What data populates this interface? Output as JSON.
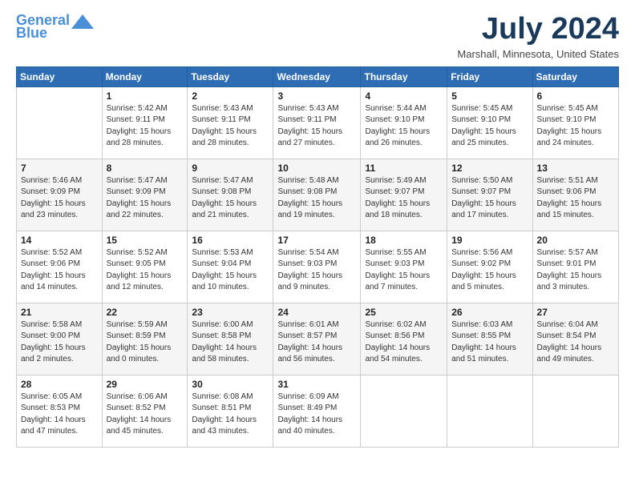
{
  "header": {
    "logo_line1": "General",
    "logo_line2": "Blue",
    "month": "July 2024",
    "location": "Marshall, Minnesota, United States"
  },
  "weekdays": [
    "Sunday",
    "Monday",
    "Tuesday",
    "Wednesday",
    "Thursday",
    "Friday",
    "Saturday"
  ],
  "weeks": [
    [
      {
        "day": "",
        "info": ""
      },
      {
        "day": "1",
        "info": "Sunrise: 5:42 AM\nSunset: 9:11 PM\nDaylight: 15 hours\nand 28 minutes."
      },
      {
        "day": "2",
        "info": "Sunrise: 5:43 AM\nSunset: 9:11 PM\nDaylight: 15 hours\nand 28 minutes."
      },
      {
        "day": "3",
        "info": "Sunrise: 5:43 AM\nSunset: 9:11 PM\nDaylight: 15 hours\nand 27 minutes."
      },
      {
        "day": "4",
        "info": "Sunrise: 5:44 AM\nSunset: 9:10 PM\nDaylight: 15 hours\nand 26 minutes."
      },
      {
        "day": "5",
        "info": "Sunrise: 5:45 AM\nSunset: 9:10 PM\nDaylight: 15 hours\nand 25 minutes."
      },
      {
        "day": "6",
        "info": "Sunrise: 5:45 AM\nSunset: 9:10 PM\nDaylight: 15 hours\nand 24 minutes."
      }
    ],
    [
      {
        "day": "7",
        "info": "Sunrise: 5:46 AM\nSunset: 9:09 PM\nDaylight: 15 hours\nand 23 minutes."
      },
      {
        "day": "8",
        "info": "Sunrise: 5:47 AM\nSunset: 9:09 PM\nDaylight: 15 hours\nand 22 minutes."
      },
      {
        "day": "9",
        "info": "Sunrise: 5:47 AM\nSunset: 9:08 PM\nDaylight: 15 hours\nand 21 minutes."
      },
      {
        "day": "10",
        "info": "Sunrise: 5:48 AM\nSunset: 9:08 PM\nDaylight: 15 hours\nand 19 minutes."
      },
      {
        "day": "11",
        "info": "Sunrise: 5:49 AM\nSunset: 9:07 PM\nDaylight: 15 hours\nand 18 minutes."
      },
      {
        "day": "12",
        "info": "Sunrise: 5:50 AM\nSunset: 9:07 PM\nDaylight: 15 hours\nand 17 minutes."
      },
      {
        "day": "13",
        "info": "Sunrise: 5:51 AM\nSunset: 9:06 PM\nDaylight: 15 hours\nand 15 minutes."
      }
    ],
    [
      {
        "day": "14",
        "info": "Sunrise: 5:52 AM\nSunset: 9:06 PM\nDaylight: 15 hours\nand 14 minutes."
      },
      {
        "day": "15",
        "info": "Sunrise: 5:52 AM\nSunset: 9:05 PM\nDaylight: 15 hours\nand 12 minutes."
      },
      {
        "day": "16",
        "info": "Sunrise: 5:53 AM\nSunset: 9:04 PM\nDaylight: 15 hours\nand 10 minutes."
      },
      {
        "day": "17",
        "info": "Sunrise: 5:54 AM\nSunset: 9:03 PM\nDaylight: 15 hours\nand 9 minutes."
      },
      {
        "day": "18",
        "info": "Sunrise: 5:55 AM\nSunset: 9:03 PM\nDaylight: 15 hours\nand 7 minutes."
      },
      {
        "day": "19",
        "info": "Sunrise: 5:56 AM\nSunset: 9:02 PM\nDaylight: 15 hours\nand 5 minutes."
      },
      {
        "day": "20",
        "info": "Sunrise: 5:57 AM\nSunset: 9:01 PM\nDaylight: 15 hours\nand 3 minutes."
      }
    ],
    [
      {
        "day": "21",
        "info": "Sunrise: 5:58 AM\nSunset: 9:00 PM\nDaylight: 15 hours\nand 2 minutes."
      },
      {
        "day": "22",
        "info": "Sunrise: 5:59 AM\nSunset: 8:59 PM\nDaylight: 15 hours\nand 0 minutes."
      },
      {
        "day": "23",
        "info": "Sunrise: 6:00 AM\nSunset: 8:58 PM\nDaylight: 14 hours\nand 58 minutes."
      },
      {
        "day": "24",
        "info": "Sunrise: 6:01 AM\nSunset: 8:57 PM\nDaylight: 14 hours\nand 56 minutes."
      },
      {
        "day": "25",
        "info": "Sunrise: 6:02 AM\nSunset: 8:56 PM\nDaylight: 14 hours\nand 54 minutes."
      },
      {
        "day": "26",
        "info": "Sunrise: 6:03 AM\nSunset: 8:55 PM\nDaylight: 14 hours\nand 51 minutes."
      },
      {
        "day": "27",
        "info": "Sunrise: 6:04 AM\nSunset: 8:54 PM\nDaylight: 14 hours\nand 49 minutes."
      }
    ],
    [
      {
        "day": "28",
        "info": "Sunrise: 6:05 AM\nSunset: 8:53 PM\nDaylight: 14 hours\nand 47 minutes."
      },
      {
        "day": "29",
        "info": "Sunrise: 6:06 AM\nSunset: 8:52 PM\nDaylight: 14 hours\nand 45 minutes."
      },
      {
        "day": "30",
        "info": "Sunrise: 6:08 AM\nSunset: 8:51 PM\nDaylight: 14 hours\nand 43 minutes."
      },
      {
        "day": "31",
        "info": "Sunrise: 6:09 AM\nSunset: 8:49 PM\nDaylight: 14 hours\nand 40 minutes."
      },
      {
        "day": "",
        "info": ""
      },
      {
        "day": "",
        "info": ""
      },
      {
        "day": "",
        "info": ""
      }
    ]
  ]
}
